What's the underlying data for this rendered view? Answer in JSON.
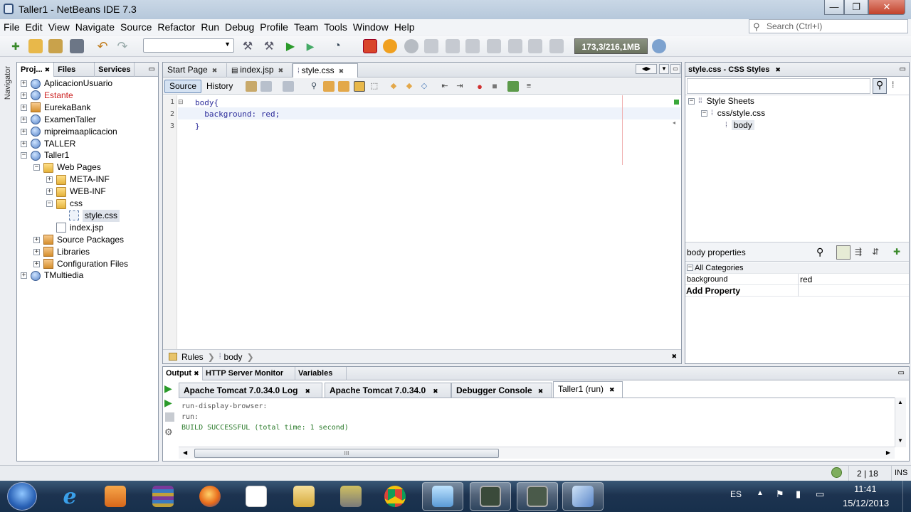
{
  "window": {
    "title": "Taller1 - NetBeans IDE 7.3",
    "minimize_glyph": "—",
    "maximize_glyph": "❐",
    "close_glyph": "✕"
  },
  "menu": [
    "File",
    "Edit",
    "View",
    "Navigate",
    "Source",
    "Refactor",
    "Run",
    "Debug",
    "Profile",
    "Team",
    "Tools",
    "Window",
    "Help"
  ],
  "search": {
    "placeholder": "Search (Ctrl+I)"
  },
  "toolbar": {
    "memory": "173,3/216,1MB"
  },
  "navigator": {
    "label": "Navigator"
  },
  "projects_panel": {
    "tabs": [
      "Proj...",
      "Files",
      "Services"
    ],
    "tree": [
      {
        "label": "AplicacionUsuario",
        "level": 0,
        "icon": "globe",
        "expand": "+"
      },
      {
        "label": "Estante",
        "level": 0,
        "icon": "globe",
        "expand": "+",
        "color": "#cc2222"
      },
      {
        "label": "EurekaBank",
        "level": 0,
        "icon": "cup",
        "expand": "+"
      },
      {
        "label": "ExamenTaller",
        "level": 0,
        "icon": "globe",
        "expand": "+"
      },
      {
        "label": "mipreimaaplicacion",
        "level": 0,
        "icon": "globe",
        "expand": "+"
      },
      {
        "label": "TALLER",
        "level": 0,
        "icon": "globe",
        "expand": "+"
      },
      {
        "label": "Taller1",
        "level": 0,
        "icon": "globe",
        "expand": "−"
      },
      {
        "label": "Web Pages",
        "level": 1,
        "icon": "folder",
        "expand": "−"
      },
      {
        "label": "META-INF",
        "level": 2,
        "icon": "folder",
        "expand": "+"
      },
      {
        "label": "WEB-INF",
        "level": 2,
        "icon": "folder",
        "expand": "+"
      },
      {
        "label": "css",
        "level": 2,
        "icon": "folder",
        "expand": "−"
      },
      {
        "label": "style.css",
        "level": 3,
        "icon": "cssf",
        "expand": "",
        "selected": true
      },
      {
        "label": "index.jsp",
        "level": 2,
        "icon": "file",
        "expand": ""
      },
      {
        "label": "Source Packages",
        "level": 1,
        "icon": "pkg",
        "expand": "+"
      },
      {
        "label": "Libraries",
        "level": 1,
        "icon": "pkg",
        "expand": "+"
      },
      {
        "label": "Configuration Files",
        "level": 1,
        "icon": "pkg",
        "expand": "+"
      },
      {
        "label": "TMultiedia",
        "level": 0,
        "icon": "globe",
        "expand": "+"
      }
    ]
  },
  "editor": {
    "tabs": [
      {
        "label": "Start Page",
        "active": false
      },
      {
        "label": "index.jsp",
        "active": false
      },
      {
        "label": "style.css",
        "active": true
      }
    ],
    "source_label": "Source",
    "history_label": "History",
    "line_numbers": [
      "1",
      "2",
      "3"
    ],
    "lines": [
      "body{",
      "  background: red;",
      "}"
    ],
    "breadcrumbs": [
      "Rules",
      "body"
    ]
  },
  "css_styles": {
    "title": "style.css - CSS Styles",
    "tree": [
      "Style Sheets",
      "css/style.css",
      "body"
    ],
    "properties_title": "body properties",
    "category": "All Categories",
    "property_name": "background",
    "property_value": "red",
    "add_property": "Add Property"
  },
  "output": {
    "tabs": [
      "Output",
      "HTTP Server Monitor",
      "Variables"
    ],
    "inner_tabs": [
      {
        "label": "Apache Tomcat 7.0.34.0 Log",
        "active": false
      },
      {
        "label": "Apache Tomcat 7.0.34.0",
        "active": false
      },
      {
        "label": "Debugger Console",
        "active": false
      },
      {
        "label": "Taller1 (run)",
        "active": true
      }
    ],
    "lines": [
      "run-display-browser:",
      "run:",
      "BUILD SUCCESSFUL (total time: 1 second)"
    ],
    "success_color": "#2a7a2a",
    "scroll_grip": "III"
  },
  "status": {
    "position": "2 | 18",
    "mode": "INS"
  },
  "taskbar": {
    "language": "ES",
    "time": "11:41",
    "date": "15/12/2013"
  }
}
